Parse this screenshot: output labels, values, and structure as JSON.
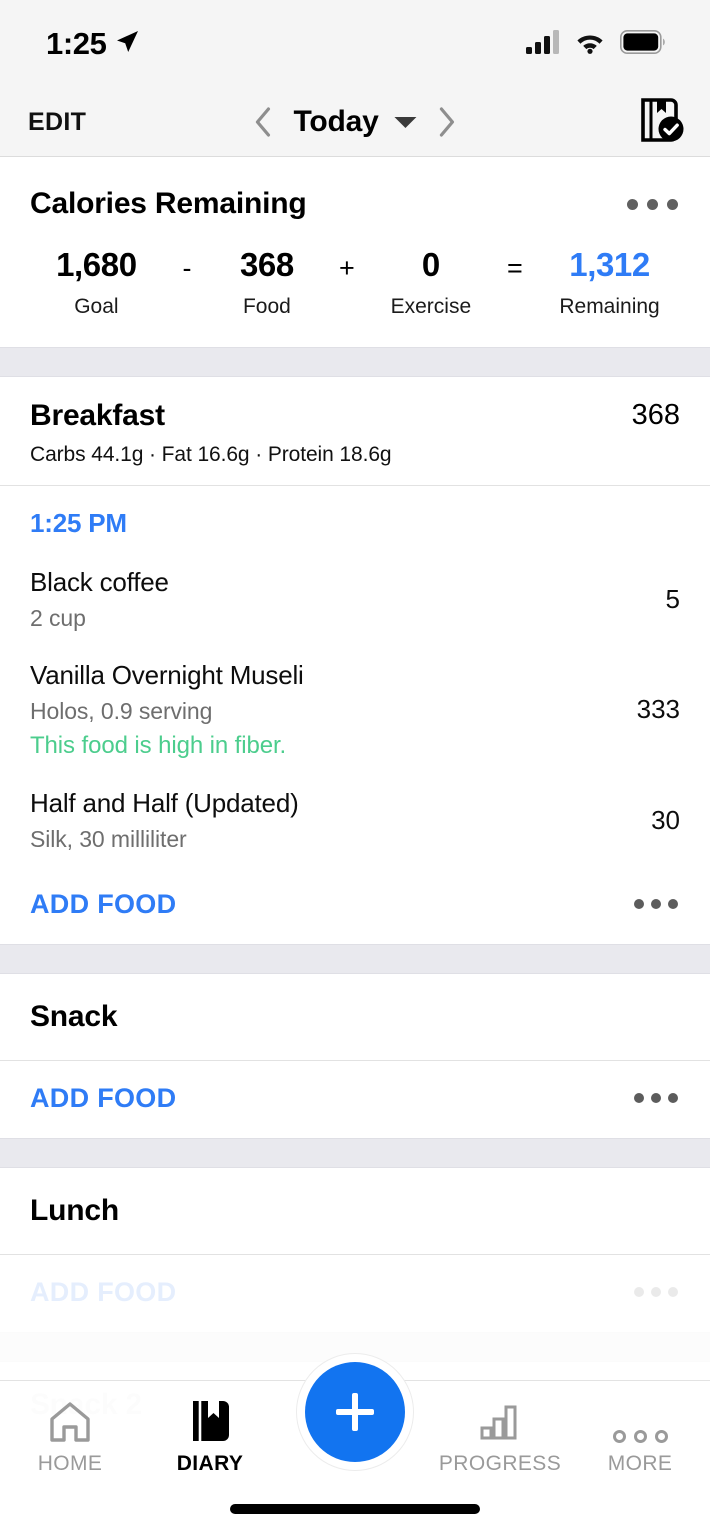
{
  "status_bar": {
    "time": "1:25",
    "location_icon": "location-arrow-icon",
    "cellular_icon": "cellular-signal-icon",
    "wifi_icon": "wifi-icon",
    "battery_icon": "battery-full-icon"
  },
  "nav": {
    "edit_label": "EDIT",
    "date_label": "Today",
    "prev_icon": "chevron-left-icon",
    "next_icon": "chevron-right-icon",
    "caret_icon": "chevron-down-icon",
    "diary_check_icon": "diary-complete-icon"
  },
  "calories": {
    "title": "Calories Remaining",
    "menu_icon": "overflow-menu-icon",
    "goal_value": "1,680",
    "goal_label": "Goal",
    "op_minus": "-",
    "food_value": "368",
    "food_label": "Food",
    "op_plus": "+",
    "exercise_value": "0",
    "exercise_label": "Exercise",
    "op_equals": "=",
    "remaining_value": "1,312",
    "remaining_label": "Remaining",
    "remaining_color": "#2f7cf6"
  },
  "meals": [
    {
      "name": "Breakfast",
      "calories": "368",
      "macros": "Carbs 44.1g · Fat 16.6g · Protein 18.6g",
      "time_stamp": "1:25 PM",
      "entries": [
        {
          "name": "Black coffee",
          "sub": "2 cup",
          "calories": "5",
          "note": ""
        },
        {
          "name": "Vanilla Overnight Museli",
          "sub": "Holos, 0.9 serving",
          "calories": "333",
          "note": "This food is high in fiber."
        },
        {
          "name": "Half and Half (Updated)",
          "sub": "Silk, 30 milliliter",
          "calories": "30",
          "note": ""
        }
      ],
      "add_food_label": "ADD FOOD"
    },
    {
      "name": "Snack",
      "calories": "",
      "macros": "",
      "time_stamp": "",
      "entries": [],
      "add_food_label": "ADD FOOD"
    },
    {
      "name": "Lunch",
      "calories": "",
      "macros": "",
      "time_stamp": "",
      "entries": [],
      "add_food_label": "ADD FOOD"
    }
  ],
  "partial_bottom": {
    "lunch_add_food_label": "ADD FOOD",
    "next_meal_name": "Snack 2"
  },
  "tabbar": {
    "home_label": "HOME",
    "home_icon": "home-icon",
    "diary_label": "DIARY",
    "diary_icon": "diary-book-icon",
    "add_icon": "plus-icon",
    "progress_label": "PROGRESS",
    "progress_icon": "bar-chart-icon",
    "more_label": "MORE",
    "more_icon": "more-dots-icon",
    "active_tab": "DIARY",
    "accent_color": "#1274f0"
  },
  "colors": {
    "accent_blue": "#2f7cf6",
    "fiber_green": "#4ccd8d",
    "band_gray": "#e9e9ee",
    "header_gray": "#f5f5f5"
  }
}
